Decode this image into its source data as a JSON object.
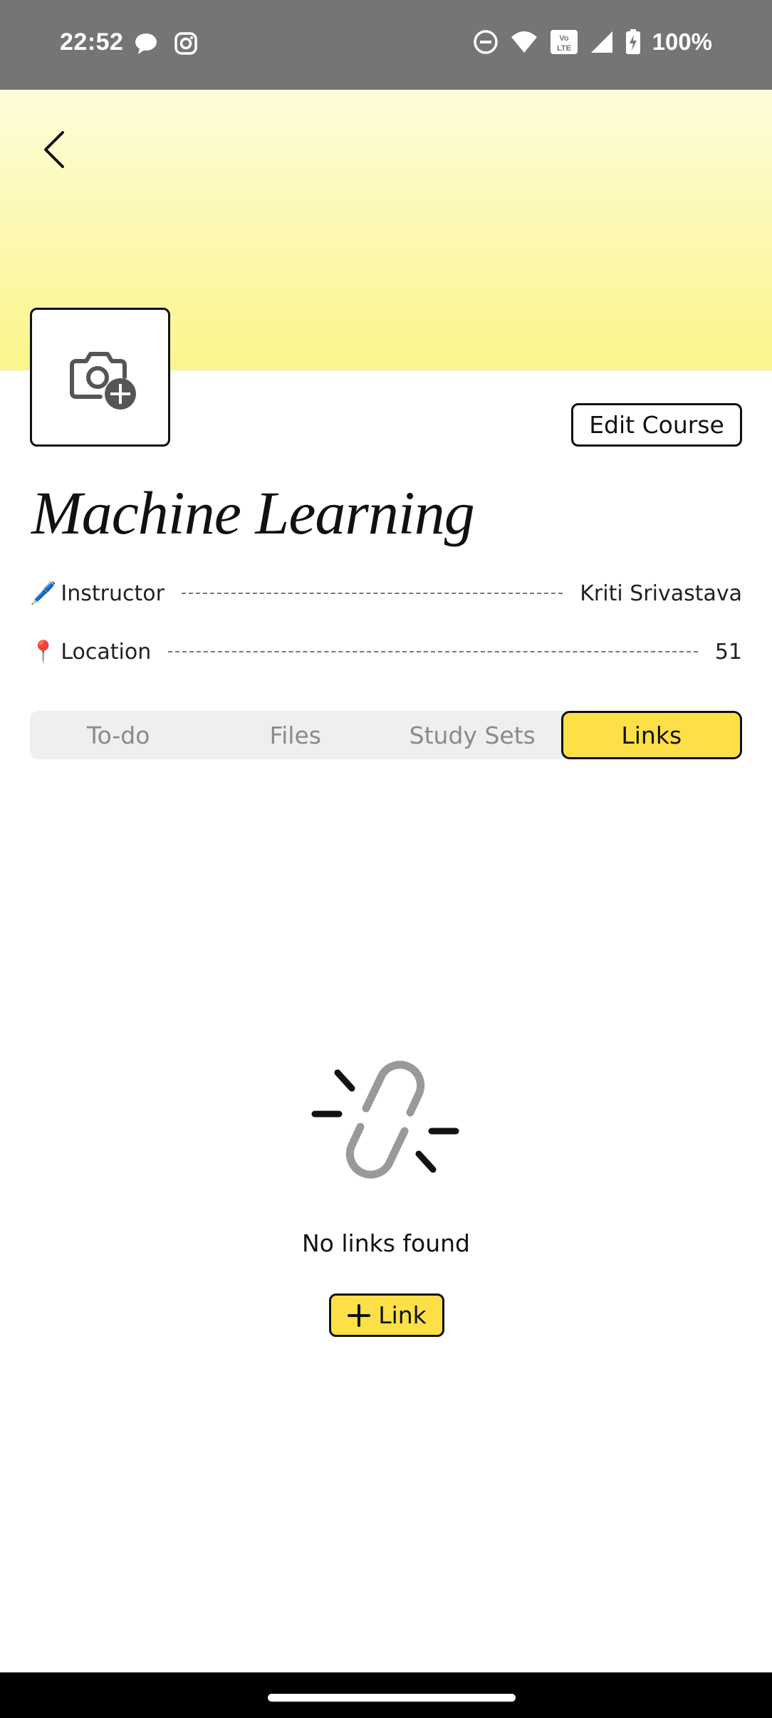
{
  "status_bar": {
    "time": "22:52",
    "battery": "100%",
    "icons": [
      "chat-bubble-icon",
      "instagram-icon",
      "do-not-disturb-icon",
      "wifi-icon",
      "volte-icon",
      "signal-icon",
      "battery-charging-icon"
    ]
  },
  "header": {
    "back_icon": "chevron-left-icon",
    "banner_colors": [
      "#fefdd9",
      "#faf58b"
    ]
  },
  "course": {
    "cover_icon": "camera-add-icon",
    "edit_label": "Edit Course",
    "title": "Machine Learning",
    "instructor_icon": "🖊️",
    "instructor_label": "Instructor",
    "instructor_value": "Kriti Srivastava",
    "location_icon": "📍",
    "location_label": "Location",
    "location_value": "51"
  },
  "tabs": [
    {
      "label": "To-do",
      "active": false
    },
    {
      "label": "Files",
      "active": false
    },
    {
      "label": "Study Sets",
      "active": false
    },
    {
      "label": "Links",
      "active": true
    }
  ],
  "empty_state": {
    "icon": "broken-link-icon",
    "message": "No links found",
    "add_button_label": "Link",
    "add_button_icon": "plus-icon"
  },
  "colors": {
    "accent": "#fde047",
    "status_bar": "#757575",
    "tab_inactive_text": "#8a8a8a"
  }
}
